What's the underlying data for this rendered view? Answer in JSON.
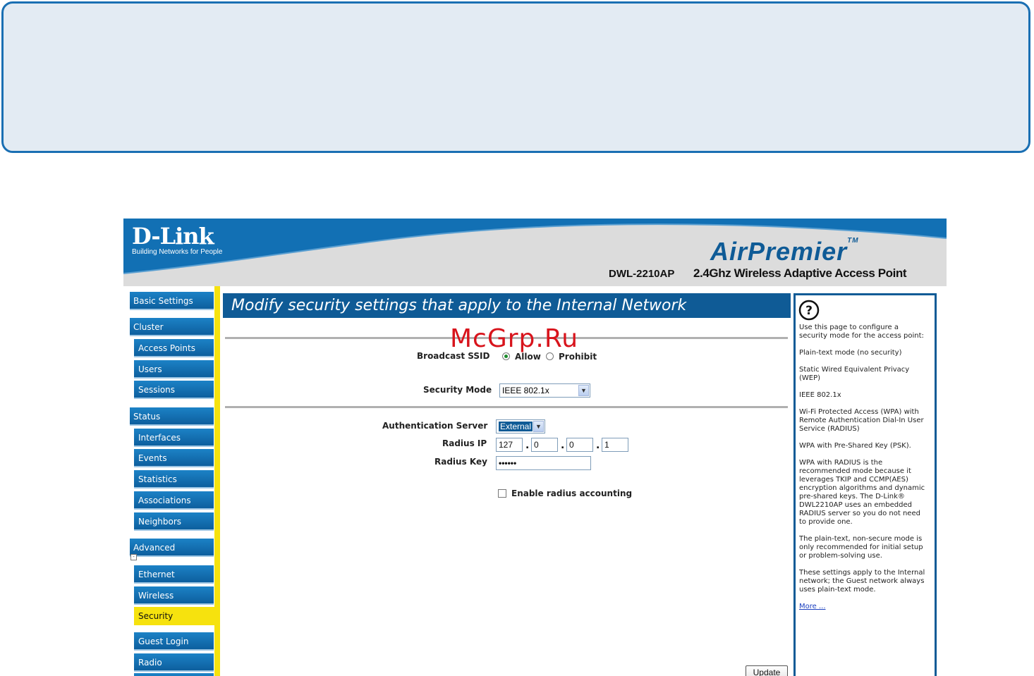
{
  "watermark": "McGrp.Ru",
  "header": {
    "brand": "D-Link",
    "tagline": "Building Networks for People",
    "product_line": "AirPremier",
    "model": "DWL-2210AP",
    "product_desc": "2.4Ghz Wireless Adaptive Access Point"
  },
  "nav": {
    "basic_settings": "Basic Settings",
    "cluster": "Cluster",
    "access_points": "Access Points",
    "users": "Users",
    "sessions": "Sessions",
    "status": "Status",
    "interfaces": "Interfaces",
    "events": "Events",
    "statistics": "Statistics",
    "associations": "Associations",
    "neighbors": "Neighbors",
    "advanced": "Advanced",
    "ethernet": "Ethernet",
    "wireless": "Wireless",
    "security": "Security",
    "guest_login": "Guest Login",
    "radio": "Radio",
    "active": "Security"
  },
  "main": {
    "title": "Modify security settings that apply to the Internal Network",
    "broadcast_ssid_label": "Broadcast SSID",
    "allow": "Allow",
    "prohibit": "Prohibit",
    "broadcast_ssid_value": "Allow",
    "security_mode_label": "Security Mode",
    "security_mode_value": "IEEE 802.1x",
    "auth_server_label": "Authentication Server",
    "auth_server_value": "External",
    "radius_ip_label": "Radius IP",
    "radius_ip": [
      "127",
      "0",
      "0",
      "1"
    ],
    "radius_key_label": "Radius Key",
    "radius_key_value": "••••••",
    "enable_accounting_label": "Enable radius accounting",
    "enable_accounting_checked": false,
    "update_button": "Update"
  },
  "help": {
    "icon": "question-mark-icon",
    "paragraphs": [
      "Use this page to configure a security mode for the access point:",
      "Plain-text mode (no security)",
      "Static Wired Equivalent Privacy (WEP)",
      "IEEE 802.1x",
      "Wi-Fi Protected Access (WPA) with Remote Authentication Dial-In User Service (RADIUS)",
      "WPA with Pre-Shared Key (PSK).",
      "WPA with RADIUS is the recommended mode because it leverages TKIP and CCMP(AES) encryption algorithms and dynamic pre-shared keys. The D-Link® DWL2210AP uses an embedded RADIUS server so you do not need to provide one.",
      "The plain-text, non-secure mode is only recommended for initial setup or problem-solving use.",
      "These settings apply to the Internal network; the Guest network always uses plain-text mode."
    ],
    "more_link": "More ..."
  },
  "colors": {
    "nav_blue": "#1270b4",
    "title_blue": "#0f5b96",
    "active_yellow": "#f6e20e",
    "watermark_red": "#d8141c"
  }
}
